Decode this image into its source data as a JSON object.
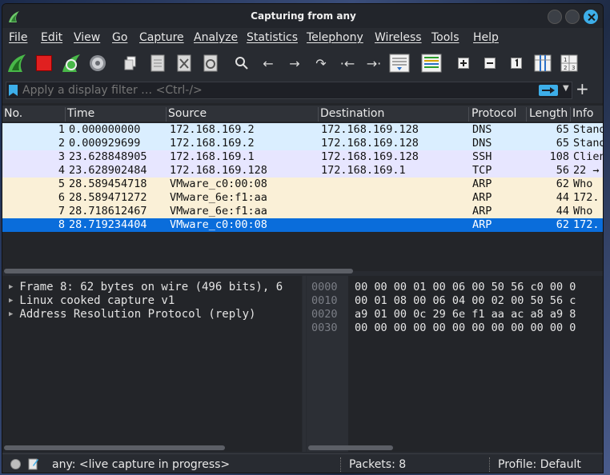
{
  "window": {
    "title": "Capturing from any"
  },
  "menu": [
    "File",
    "Edit",
    "View",
    "Go",
    "Capture",
    "Analyze",
    "Statistics",
    "Telephony",
    "Wireless",
    "Tools",
    "Help"
  ],
  "filter": {
    "placeholder": "Apply a display filter … <Ctrl-/>"
  },
  "columns": [
    "No.",
    "Time",
    "Source",
    "Destination",
    "Protocol",
    "Length",
    "Info"
  ],
  "colors": {
    "dns_row": "#daeeff",
    "ssh_row": "#e7e6ff",
    "arp_row": "#faf0d7",
    "selected_row": "#0a6ddb",
    "accent": "#3daee9"
  },
  "packets": [
    {
      "no": "1",
      "time": "0.000000000",
      "src": "172.168.169.2",
      "dst": "172.168.169.128",
      "proto": "DNS",
      "len": "65",
      "info": "Standard query"
    },
    {
      "no": "2",
      "time": "0.000929699",
      "src": "172.168.169.2",
      "dst": "172.168.169.128",
      "proto": "DNS",
      "len": "65",
      "info": "Standard query"
    },
    {
      "no": "3",
      "time": "23.628848905",
      "src": "172.168.169.1",
      "dst": "172.168.169.128",
      "proto": "SSH",
      "len": "108",
      "info": "Client"
    },
    {
      "no": "4",
      "time": "23.628902484",
      "src": "172.168.169.128",
      "dst": "172.168.169.1",
      "proto": "TCP",
      "len": "56",
      "info": "22 →"
    },
    {
      "no": "5",
      "time": "28.589454718",
      "src": "VMware_c0:00:08",
      "dst": "",
      "proto": "ARP",
      "len": "62",
      "info": "Who"
    },
    {
      "no": "6",
      "time": "28.589471272",
      "src": "VMware_6e:f1:aa",
      "dst": "",
      "proto": "ARP",
      "len": "44",
      "info": "172."
    },
    {
      "no": "7",
      "time": "28.718612467",
      "src": "VMware_6e:f1:aa",
      "dst": "",
      "proto": "ARP",
      "len": "44",
      "info": "Who"
    },
    {
      "no": "8",
      "time": "28.719234404",
      "src": "VMware_c0:00:08",
      "dst": "",
      "proto": "ARP",
      "len": "62",
      "info": "172."
    }
  ],
  "details": [
    "Frame 8: 62 bytes on wire (496 bits), 6",
    "Linux cooked capture v1",
    "Address Resolution Protocol (reply)"
  ],
  "hex": [
    {
      "offset": "0000",
      "bytes": "00 00 00 01 00 06 00 50  56 c0 00 0"
    },
    {
      "offset": "0010",
      "bytes": "00 01 08 00 06 04 00 02  00 50 56 c"
    },
    {
      "offset": "0020",
      "bytes": "a9 01 00 0c 29 6e f1 aa  ac a8 a9 8"
    },
    {
      "offset": "0030",
      "bytes": "00 00 00 00 00 00 00 00  00 00 00 0"
    }
  ],
  "status": {
    "capture": "any: <live capture in progress>",
    "packets": "Packets: 8",
    "profile": "Profile: Default"
  }
}
